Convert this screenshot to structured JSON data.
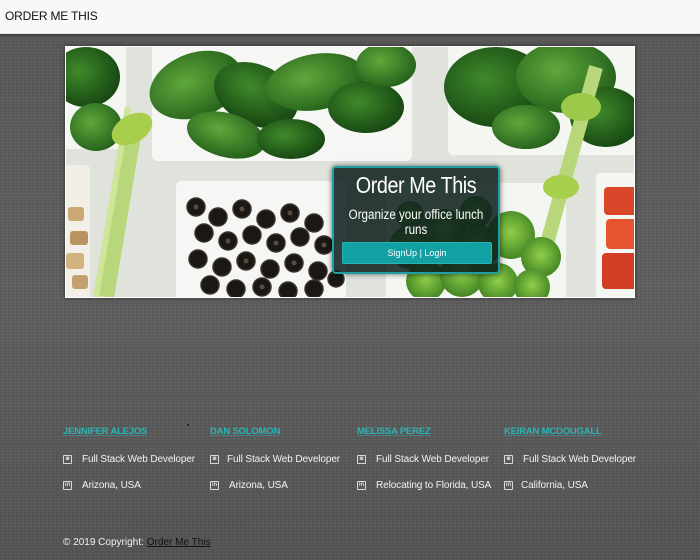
{
  "navbar": {
    "brand": "ORDER ME THIS"
  },
  "hero": {
    "title": "Order Me This",
    "subtitle": "Organize your office lunch runs",
    "button_label": "SignUp | Login",
    "accent_color": "#12a0a2"
  },
  "team": [
    {
      "name": "JENNIFER ALEJOS",
      "role": "Full Stack Web Developer",
      "location": "Arizona, USA"
    },
    {
      "name": "DAN SOLOMON",
      "role": "Full Stack Web Developer",
      "location": "Arizona, USA"
    },
    {
      "name": "MELISSA PEREZ",
      "role": "Full Stack Web Developer",
      "location": "Relocating to Florida, USA"
    },
    {
      "name": "KEIRAN MCDOUGALL",
      "role": "Full Stack Web Developer",
      "location": "California, USA"
    }
  ],
  "icons": {
    "role_icon": "github-icon",
    "location_icon": "linkedin-icon"
  },
  "footer": {
    "copyright": "© 2019 Copyright:",
    "link_text": "Order Me This"
  }
}
